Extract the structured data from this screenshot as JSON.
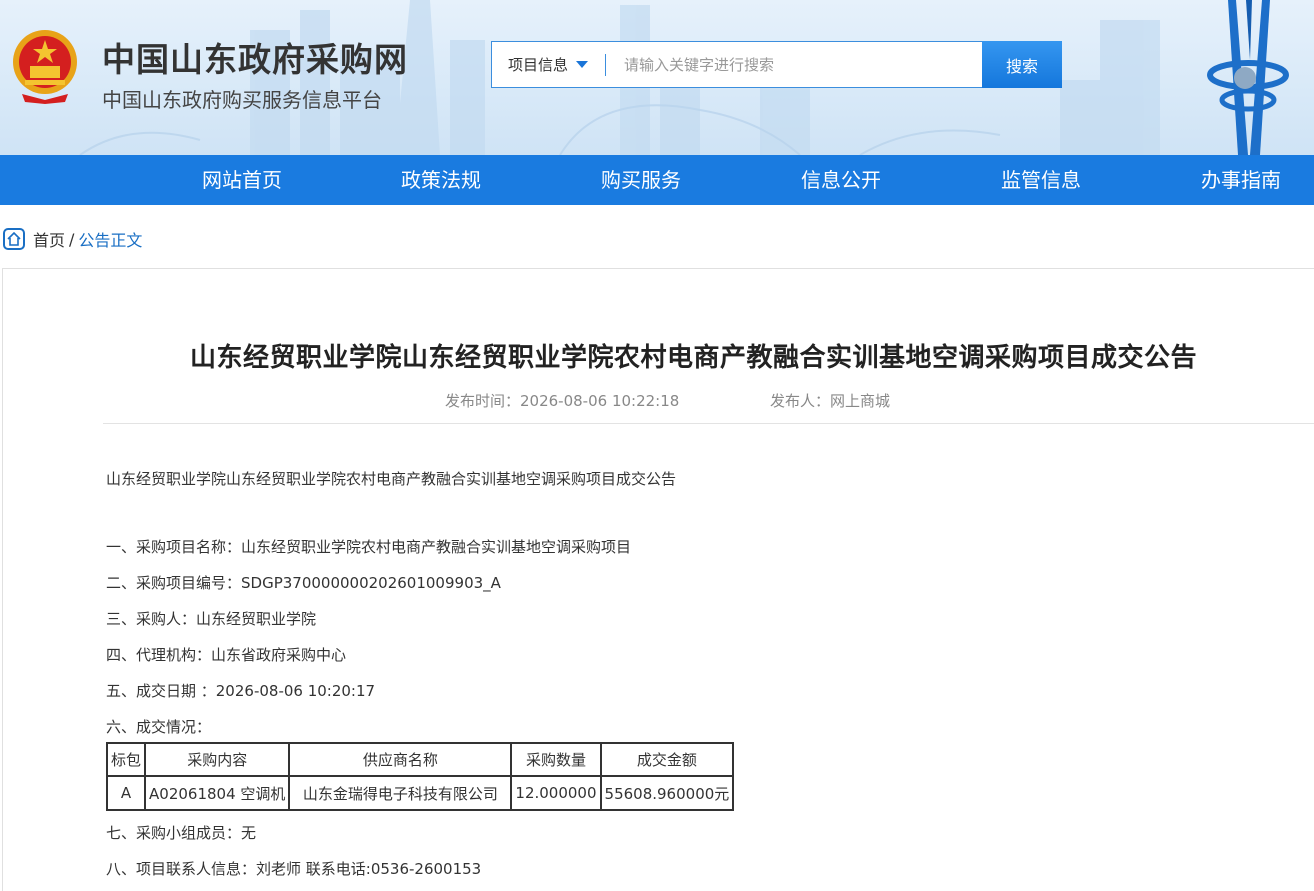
{
  "header": {
    "site_title": "中国山东政府采购网",
    "site_subtitle": "中国山东政府购买服务信息平台",
    "search": {
      "category_selected": "项目信息",
      "placeholder": "请输入关键字进行搜索",
      "button_label": "搜索"
    }
  },
  "nav": {
    "items": [
      {
        "label": "网站首页"
      },
      {
        "label": "政策法规"
      },
      {
        "label": "购买服务"
      },
      {
        "label": "信息公开"
      },
      {
        "label": "监管信息"
      },
      {
        "label": "办事指南"
      }
    ]
  },
  "breadcrumb": {
    "home": "首页",
    "separator": "/",
    "current": "公告正文"
  },
  "article": {
    "title": "山东经贸职业学院山东经贸职业学院农村电商产教融合实训基地空调采购项目成交公告",
    "publish_time": "发布时间：2026-08-06 10:22:18",
    "publisher": "发布人：网上商城",
    "intro": "山东经贸职业学院山东经贸职业学院农村电商产教融合实训基地空调采购项目成交公告",
    "items": [
      "一、采购项目名称：山东经贸职业学院农村电商产教融合实训基地空调采购项目",
      "二、采购项目编号：SDGP370000000202601009903_A",
      "三、采购人：山东经贸职业学院",
      "四、代理机构：山东省政府采购中心",
      "五、成交日期 ：2026-08-06 10:20:17",
      "六、成交情况："
    ],
    "table": {
      "headers": [
        "标包",
        "采购内容",
        "供应商名称",
        "采购数量",
        "成交金额"
      ],
      "rows": [
        [
          "A",
          "A02061804 空调机",
          "山东金瑞得电子科技有限公司",
          "12.000000",
          "55608.960000元"
        ]
      ]
    },
    "items_after": [
      "七、采购小组成员：无",
      "八、项目联系人信息：刘老师 联系电话:0536-2600153"
    ]
  },
  "colors": {
    "nav_bg": "#1a7be0",
    "link_blue": "#1a6fc4",
    "search_border": "#3b8ede"
  }
}
